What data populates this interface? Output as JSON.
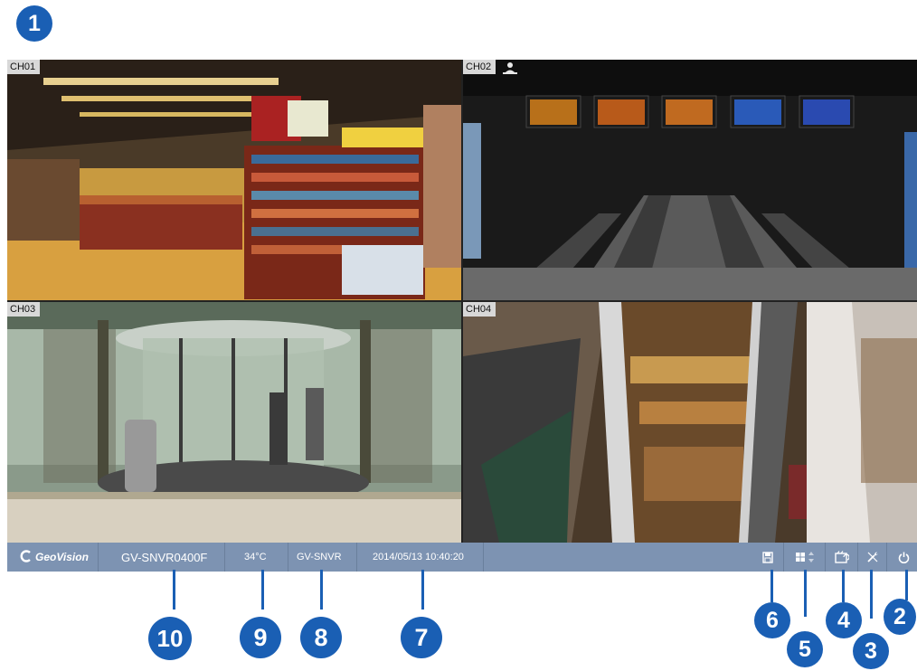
{
  "callouts": {
    "c1": "1",
    "c2": "2",
    "c3": "3",
    "c4": "4",
    "c5": "5",
    "c6": "6",
    "c7": "7",
    "c8": "8",
    "c9": "9",
    "c10": "10"
  },
  "channels": {
    "ch1": "CH01",
    "ch2": "CH02",
    "ch3": "CH03",
    "ch4": "CH04"
  },
  "status_bar": {
    "logo": "GeoVision",
    "device_model": "GV-SNVR0400F",
    "temperature": "34°C",
    "host_name": "GV-SNVR",
    "datetime": "2014/05/13 10:40:20"
  },
  "icons": [
    "save-icon",
    "layout-grid-icon",
    "playback-icon",
    "settings-icon",
    "power-icon",
    "person-icon"
  ],
  "colors": {
    "callout": "#1a5fb4",
    "status_bar": "#7d93b2"
  }
}
